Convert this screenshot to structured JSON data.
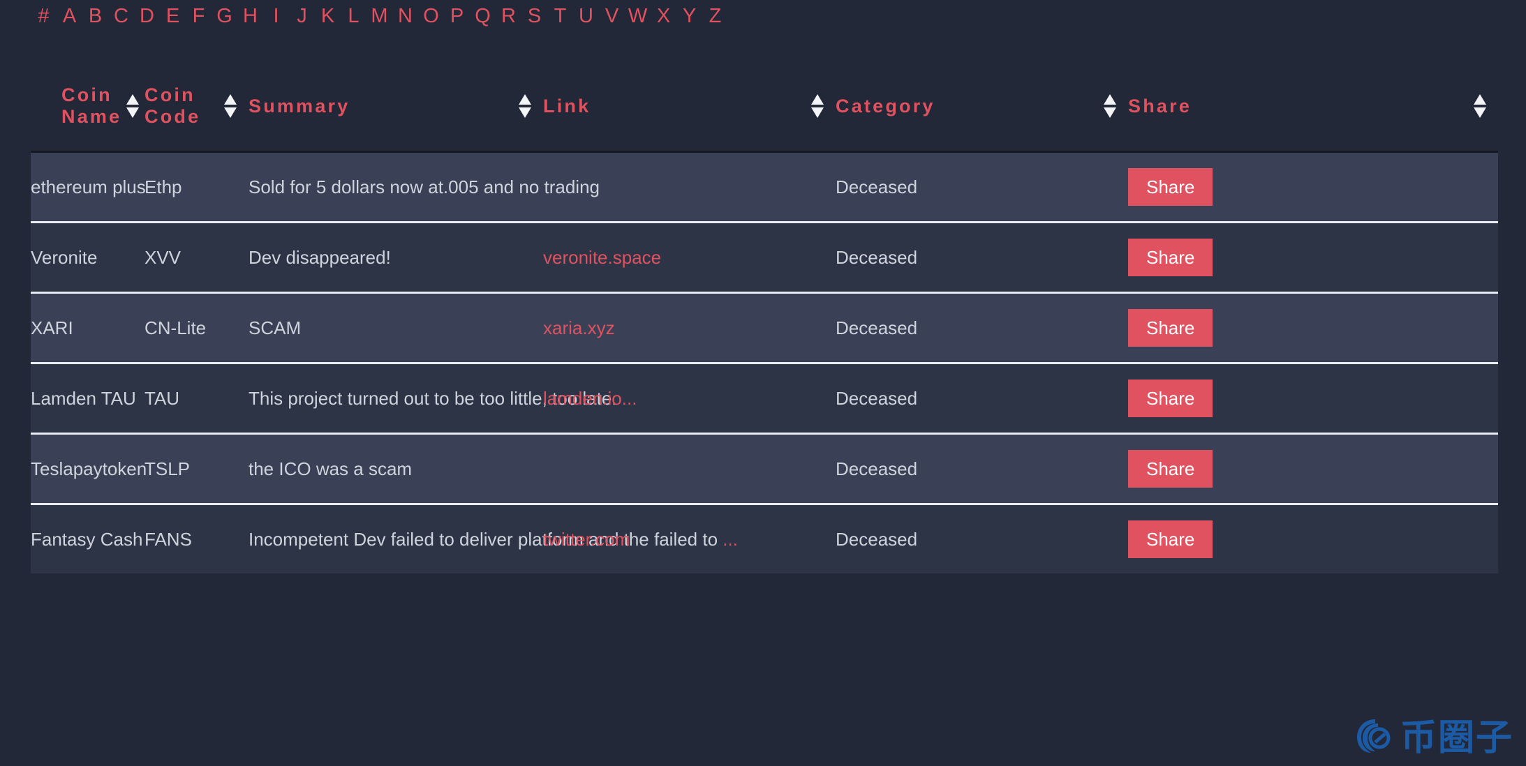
{
  "alphabet_nav": {
    "items": [
      "#",
      "A",
      "B",
      "C",
      "D",
      "E",
      "F",
      "G",
      "H",
      "I",
      "J",
      "K",
      "L",
      "M",
      "N",
      "O",
      "P",
      "Q",
      "R",
      "S",
      "T",
      "U",
      "V",
      "W",
      "X",
      "Y",
      "Z"
    ]
  },
  "colors": {
    "page_background": "#222838",
    "accent_red": "#e0525f",
    "row_light": "#3a4156",
    "row_dark": "#2d3446",
    "row_divider": "#e9ecf1",
    "body_text": "#ced3dc",
    "watermark_blue": "#1c5fae"
  },
  "table": {
    "columns": [
      {
        "label": "Coin Name",
        "sortable": true,
        "sort_icon": "sort-updown-icon"
      },
      {
        "label": "Coin Code",
        "sortable": true,
        "sort_icon": "sort-updown-icon"
      },
      {
        "label": "Summary",
        "sortable": true,
        "sort_icon": "sort-updown-icon"
      },
      {
        "label": "Link",
        "sortable": true,
        "sort_icon": "sort-updown-icon"
      },
      {
        "label": "Category",
        "sortable": true,
        "sort_icon": "sort-updown-icon"
      },
      {
        "label": "Share",
        "sortable": true,
        "sort_icon": "sort-updown-icon"
      }
    ],
    "share_label": "Share",
    "truncation_marker": "...",
    "rows": [
      {
        "coin_name": "ethereum plus",
        "coin_code": "Ethp",
        "summary": "Sold for 5 dollars now at.005 and no trading",
        "summary_truncated": false,
        "link": "",
        "category": "Deceased"
      },
      {
        "coin_name": "Veronite",
        "coin_code": "XVV",
        "summary": "Dev disappeared!",
        "summary_truncated": false,
        "link": "veronite.space",
        "category": "Deceased"
      },
      {
        "coin_name": "XARI",
        "coin_code": "CN-Lite",
        "summary": "SCAM",
        "summary_truncated": false,
        "link": "xaria.xyz",
        "category": "Deceased"
      },
      {
        "coin_name": "Lamden TAU",
        "coin_code": "TAU",
        "summary": "This project turned out to be too little, too late.",
        "summary_truncated": true,
        "link": "lamden.io",
        "category": "Deceased"
      },
      {
        "coin_name": "Teslapaytoken",
        "coin_code": "TSLP",
        "summary": "the ICO was a scam",
        "summary_truncated": false,
        "link": "",
        "category": "Deceased"
      },
      {
        "coin_name": "Fantasy Cash",
        "coin_code": "FANS",
        "summary": "Incompetent Dev failed to deliver platform and the failed to",
        "summary_truncated": true,
        "link": "twitter.com",
        "category": "Deceased"
      }
    ]
  },
  "watermark": {
    "text": "币圈子",
    "logo_icon": "spiral-logo-icon"
  }
}
